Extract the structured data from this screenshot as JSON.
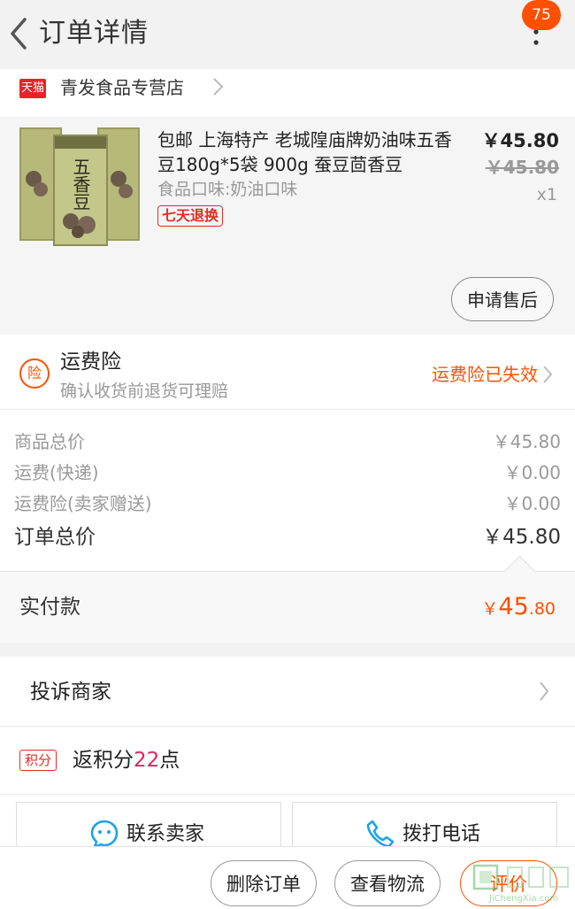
{
  "header": {
    "title": "订单详情",
    "badge_count": "75"
  },
  "store": {
    "logo_text": "天猫",
    "name": "青发食品专营店"
  },
  "product": {
    "title": "包邮 上海特产 老城隍庙牌奶油味五香豆180g*5袋 900g 蚕豆茴香豆",
    "sku": "食品口味:奶油口味",
    "return_badge": "七天退换",
    "price_now": "￥45.80",
    "price_original": "￥45.80",
    "quantity": "x1",
    "after_sale_label": "申请售后",
    "package_text": "五香豆"
  },
  "insurance": {
    "icon_text": "险",
    "title": "运费险",
    "subtitle": "确认收货前退货可理赔",
    "status": "运费险已失效"
  },
  "summary": {
    "items": [
      {
        "label": "商品总价",
        "value": "￥45.80"
      },
      {
        "label": "运费(快递)",
        "value": "￥0.00"
      },
      {
        "label": "运费险(卖家赠送)",
        "value": "￥0.00"
      }
    ],
    "total_label": "订单总价",
    "total_value": "￥45.80"
  },
  "paid": {
    "label": "实付款",
    "currency": "￥",
    "integer": "45",
    "decimal": ".80"
  },
  "complaint": {
    "label": "投诉商家"
  },
  "points": {
    "icon_text": "积分",
    "prefix": "返积分",
    "count": "22",
    "suffix": "点"
  },
  "contact": {
    "seller_label": "联系卖家",
    "phone_label": "拨打电话"
  },
  "bottom": {
    "delete_label": "删除订单",
    "logistics_label": "查看物流",
    "review_label": "评价"
  },
  "watermark": {
    "text": "JiChengXia.com"
  },
  "colors": {
    "accent": "#ff5000",
    "red": "#e02e24",
    "tmall": "#e8232a",
    "points": "#e0245e"
  }
}
